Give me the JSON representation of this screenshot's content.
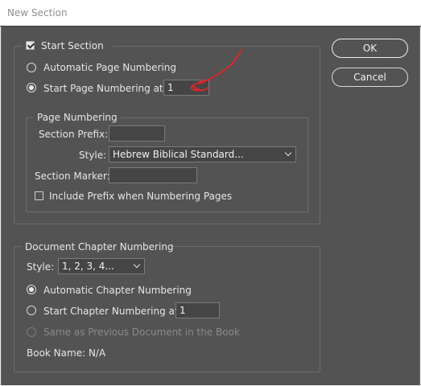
{
  "window": {
    "title": "New Section"
  },
  "buttons": {
    "ok": "OK",
    "cancel": "Cancel"
  },
  "start_section": {
    "label": "Start Section",
    "checked": true,
    "auto_numbering": "Automatic Page Numbering",
    "start_numbering": "Start Page Numbering at:",
    "start_value": "1",
    "selected": "start"
  },
  "page_numbering": {
    "legend": "Page Numbering",
    "section_prefix_label": "Section Prefix:",
    "section_prefix_value": "",
    "style_label": "Style:",
    "style_value": "Hebrew Biblical Standard...",
    "section_marker_label": "Section Marker:",
    "section_marker_value": "",
    "include_prefix_label": "Include Prefix when Numbering Pages",
    "include_prefix_checked": false
  },
  "chapter_numbering": {
    "legend": "Document Chapter Numbering",
    "style_label": "Style:",
    "style_value": "1, 2, 3, 4...",
    "auto_label": "Automatic Chapter Numbering",
    "start_label": "Start Chapter Numbering at:",
    "start_value": "1",
    "same_as_prev_label": "Same as Previous Document in the Book",
    "book_name_label": "Book Name: N/A",
    "selected": "auto"
  },
  "colors": {
    "dialog_bg": "#535353",
    "annotation": "#d9262b"
  }
}
